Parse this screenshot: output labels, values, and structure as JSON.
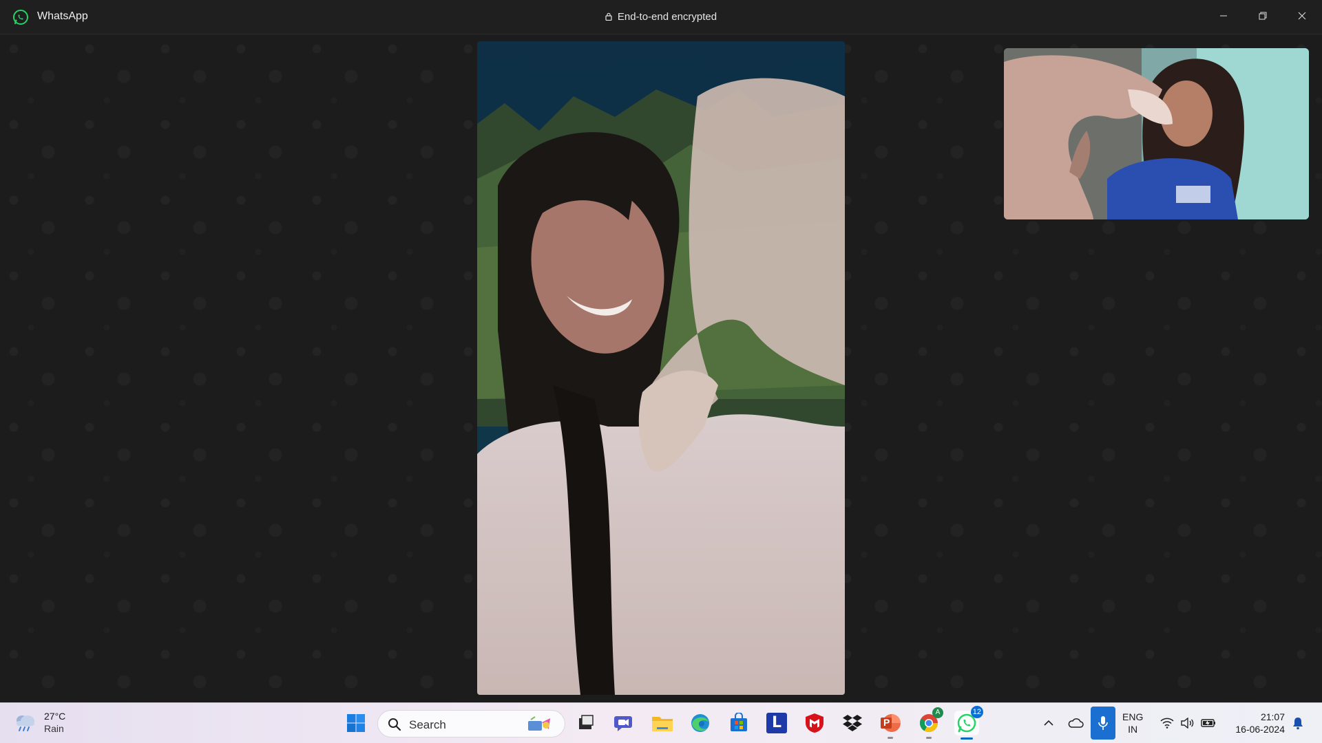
{
  "titlebar": {
    "app_name": "WhatsApp",
    "encryption_label": "End-to-end encrypted"
  },
  "call": {
    "remote_video": "remote-participant-video",
    "self_video": "self-preview-video"
  },
  "taskbar": {
    "weather": {
      "temperature": "27°C",
      "condition": "Rain"
    },
    "search": {
      "placeholder": "Search"
    },
    "apps": [
      {
        "name": "start",
        "icon": "windows-logo-icon"
      },
      {
        "name": "task-view",
        "icon": "task-view-icon"
      },
      {
        "name": "teams",
        "icon": "teams-meet-icon"
      },
      {
        "name": "file-explorer",
        "icon": "folder-icon"
      },
      {
        "name": "edge",
        "icon": "edge-icon"
      },
      {
        "name": "store",
        "icon": "store-icon"
      },
      {
        "name": "l-app",
        "icon": "l-letter-icon",
        "label": "L"
      },
      {
        "name": "mcafee",
        "icon": "shield-icon"
      },
      {
        "name": "dropbox",
        "icon": "dropbox-icon"
      },
      {
        "name": "powerpoint",
        "icon": "powerpoint-icon",
        "label": "P"
      },
      {
        "name": "chrome",
        "icon": "chrome-icon",
        "profile_letter": "A"
      },
      {
        "name": "whatsapp",
        "icon": "whatsapp-icon",
        "badge": "12"
      }
    ],
    "tray": {
      "language_line1": "ENG",
      "language_line2": "IN",
      "time": "21:07",
      "date": "16-06-2024"
    }
  },
  "colors": {
    "whatsapp_green": "#25d366",
    "accent_blue": "#0067c0"
  }
}
